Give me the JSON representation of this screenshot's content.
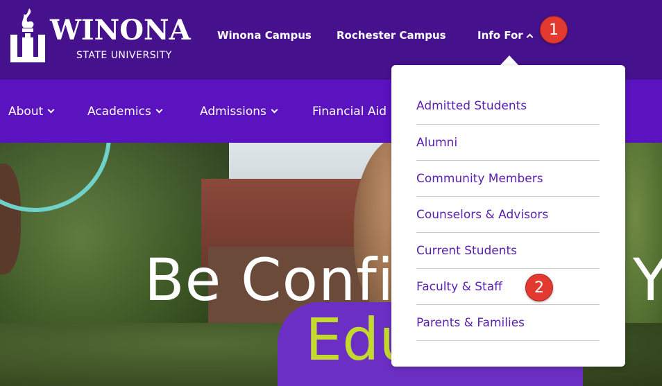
{
  "logo": {
    "wordmark": "WINONA",
    "subtitle": "STATE UNIVERSITY"
  },
  "topnav": {
    "links": [
      {
        "label": "Winona Campus"
      },
      {
        "label": "Rochester Campus"
      },
      {
        "label": "Info For"
      }
    ]
  },
  "mainnav": {
    "items": [
      {
        "label": "About"
      },
      {
        "label": "Academics"
      },
      {
        "label": "Admissions"
      },
      {
        "label": "Financial Aid"
      }
    ]
  },
  "hero": {
    "line1_start": "Be Confi",
    "line1_end": "Y",
    "line2": "Edu"
  },
  "dropdown": {
    "items": [
      {
        "label": "Admitted Students"
      },
      {
        "label": "Alumni"
      },
      {
        "label": "Community Members"
      },
      {
        "label": "Counselors & Advisors"
      },
      {
        "label": "Current Students"
      },
      {
        "label": "Faculty & Staff"
      },
      {
        "label": "Parents & Families"
      }
    ]
  },
  "callouts": [
    {
      "number": "1"
    },
    {
      "number": "2"
    }
  ],
  "colors": {
    "topbar": "#46118c",
    "mainnav": "#5b12bf",
    "dropdown_text": "#5a1fb0",
    "hero_accent": "#c4d92e",
    "callout": "#e23a31"
  },
  "icons": {
    "logo": "winona-torch-logo-icon",
    "info_for_open": "chevron-up-icon",
    "nav_dropdown": "chevron-down-icon"
  }
}
